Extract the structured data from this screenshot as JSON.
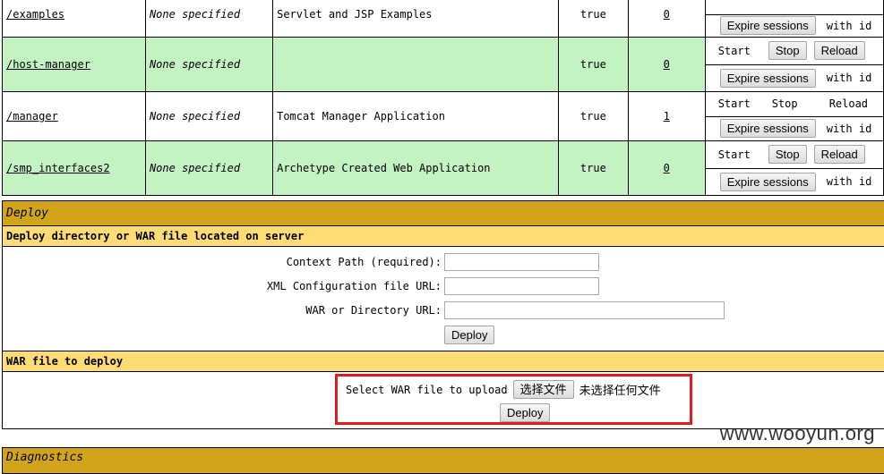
{
  "applications": {
    "rows": [
      {
        "path": "/examples",
        "version": "None specified",
        "display_name": "Servlet and JSP Examples",
        "running": "true",
        "sessions": "0",
        "style": "white",
        "commands": [
          "",
          "",
          ""
        ],
        "commands_as_buttons": false,
        "expire_label": "Expire sessions",
        "idle_text": "with id"
      },
      {
        "path": "/host-manager",
        "version": "None specified",
        "display_name": "",
        "running": "true",
        "sessions": "0",
        "style": "green",
        "commands": [
          "Start",
          "Stop",
          "Reload"
        ],
        "commands_as_buttons": true,
        "expire_label": "Expire sessions",
        "idle_text": "with id"
      },
      {
        "path": "/manager",
        "version": "None specified",
        "display_name": "Tomcat Manager Application",
        "running": "true",
        "sessions": "1",
        "style": "white",
        "commands": [
          "Start",
          "Stop",
          "Reload"
        ],
        "commands_as_buttons": false,
        "expire_label": "Expire sessions",
        "idle_text": "with id"
      },
      {
        "path": "/smp_interfaces2",
        "version": "None specified",
        "display_name": "Archetype Created Web Application",
        "running": "true",
        "sessions": "0",
        "style": "green",
        "commands": [
          "Start",
          "Stop",
          "Reload"
        ],
        "commands_as_buttons": true,
        "expire_label": "Expire sessions",
        "idle_text": "with id"
      }
    ]
  },
  "deploy": {
    "title": "Deploy",
    "server_section": {
      "title": "Deploy directory or WAR file located on server",
      "context_path_label": "Context Path (required):",
      "context_path_value": "",
      "xml_config_label": "XML Configuration file URL:",
      "xml_config_value": "",
      "war_dir_label": "WAR or Directory URL:",
      "war_dir_value": "",
      "deploy_button": "Deploy"
    },
    "war_section": {
      "title": "WAR file to deploy",
      "select_label": "Select WAR file to upload",
      "choose_file_button": "选择文件",
      "no_file_text": "未选择任何文件",
      "deploy_button": "Deploy"
    }
  },
  "diagnostics": {
    "title": "Diagnostics"
  },
  "watermark": "www.wooyun.org"
}
